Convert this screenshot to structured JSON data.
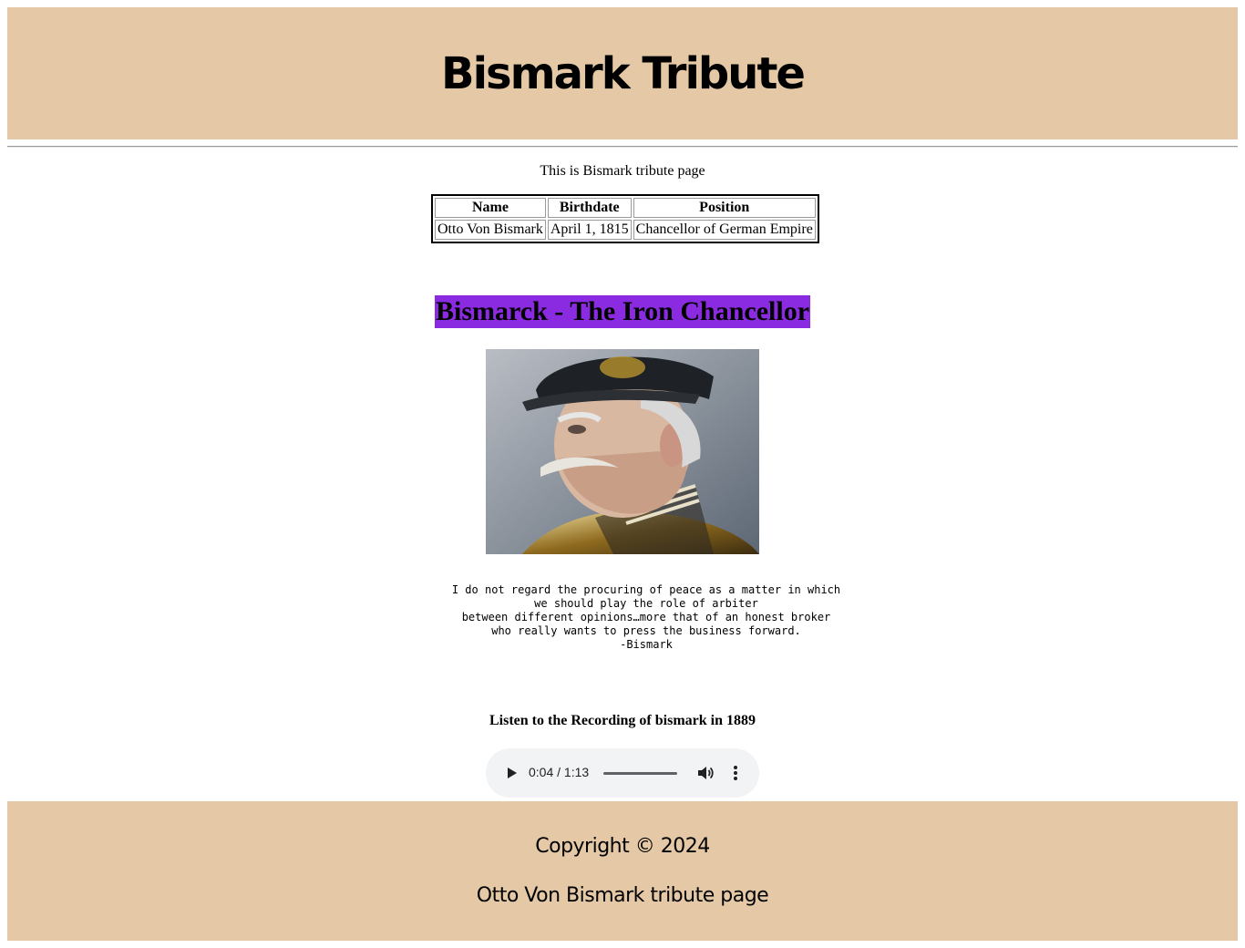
{
  "header": {
    "title": "Bismark Tribute"
  },
  "intro": "This is Bismark tribute page",
  "table": {
    "headers": [
      "Name",
      "Birthdate",
      "Position"
    ],
    "row": [
      "Otto Von Bismark",
      "April 1, 1815",
      "Chancellor of German Empire"
    ]
  },
  "subheading": "Bismarck - The Iron Chancellor",
  "quote": "I do not regard the procuring of peace as a matter in which\nwe should play the role of arbiter\nbetween different opinions…more that of an honest broker\nwho really wants to press the business forward.\n-Bismark",
  "audio": {
    "heading": "Listen to the Recording of bismark in 1889",
    "time": "0:04 / 1:13",
    "progress_fraction": 0.05
  },
  "footer": {
    "copyright": "Copyright © 2024",
    "caption": "Otto Von Bismark tribute page"
  },
  "colors": {
    "banner": "#e5c9a6",
    "highlight": "#8a2be2"
  }
}
